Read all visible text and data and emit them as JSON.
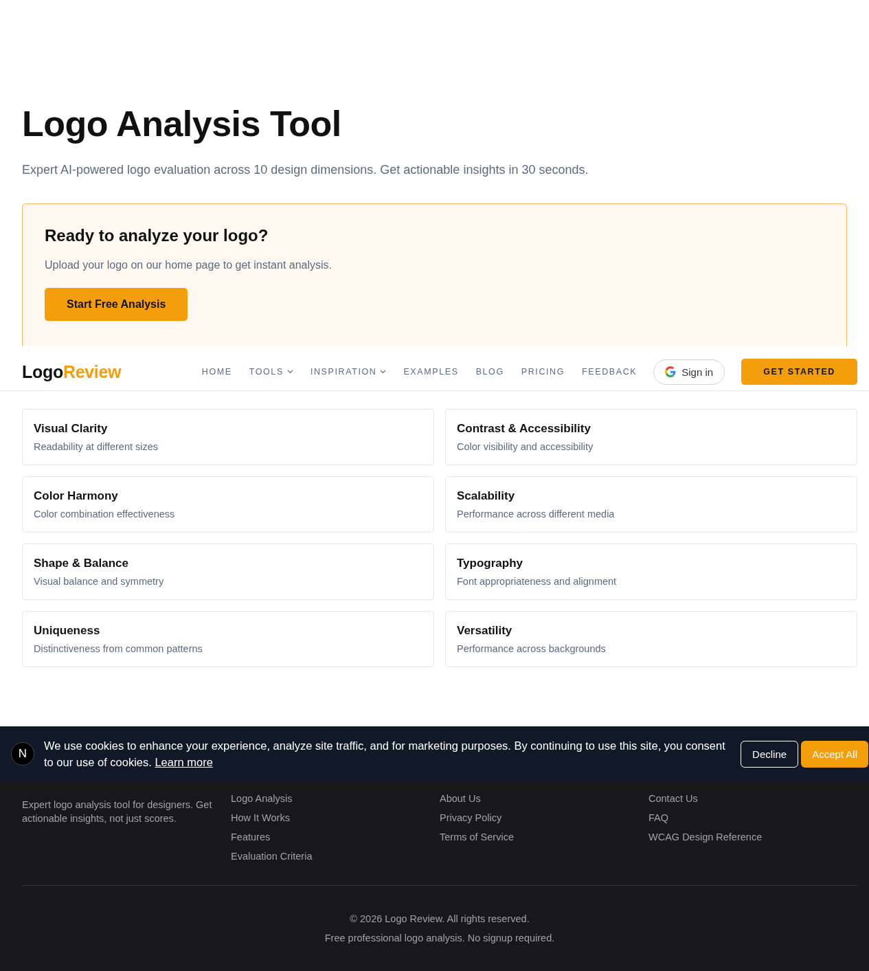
{
  "hero": {
    "title": "Logo Analysis Tool",
    "subtitle": "Expert AI-powered logo evaluation across 10 design dimensions. Get actionable insights in 30 seconds."
  },
  "cta": {
    "title": "Ready to analyze your logo?",
    "text": "Upload your logo on our home page to get instant analysis.",
    "button": "Start Free Analysis"
  },
  "header": {
    "logo_a": "Logo",
    "logo_b": "Review",
    "nav": [
      {
        "label": "HOME",
        "dropdown": false
      },
      {
        "label": "TOOLS",
        "dropdown": true
      },
      {
        "label": "INSPIRATION",
        "dropdown": true
      },
      {
        "label": "EXAMPLES",
        "dropdown": false
      },
      {
        "label": "BLOG",
        "dropdown": false
      },
      {
        "label": "PRICING",
        "dropdown": false
      },
      {
        "label": "FEEDBACK",
        "dropdown": false
      }
    ],
    "sign_in": "Sign in",
    "get_started": "GET STARTED"
  },
  "criteria": [
    {
      "title": "Visual Clarity",
      "text": "Readability at different sizes"
    },
    {
      "title": "Contrast & Accessibility",
      "text": "Color visibility and accessibility"
    },
    {
      "title": "Color Harmony",
      "text": "Color combination effectiveness"
    },
    {
      "title": "Scalability",
      "text": "Performance across different media"
    },
    {
      "title": "Shape & Balance",
      "text": "Visual balance and symmetry"
    },
    {
      "title": "Typography",
      "text": "Font appropriateness and alignment"
    },
    {
      "title": "Uniqueness",
      "text": "Distinctiveness from common patterns"
    },
    {
      "title": "Versatility",
      "text": "Performance across backgrounds"
    }
  ],
  "cookie_banner": {
    "text": "We use cookies to enhance your experience, analyze site traffic, and for marketing purposes. By continuing to use this site, you consent to our use of cookies.",
    "link": "Learn more",
    "decline": "Decline",
    "accept": "Accept All"
  },
  "dev_badge": {
    "label": "N"
  },
  "footer": {
    "tagline": "Expert logo analysis tool for designers. Get actionable insights, not just scores.",
    "columns": [
      [
        "Logo Analysis",
        "How It Works",
        "Features",
        "Evaluation Criteria"
      ],
      [
        "About Us",
        "Privacy Policy",
        "Terms of Service"
      ],
      [
        "Contact Us",
        "FAQ",
        "WCAG Design Reference"
      ]
    ],
    "copyright": "© 2026 Logo Review. All rights reserved.",
    "note": "Free professional logo analysis. No signup required."
  }
}
